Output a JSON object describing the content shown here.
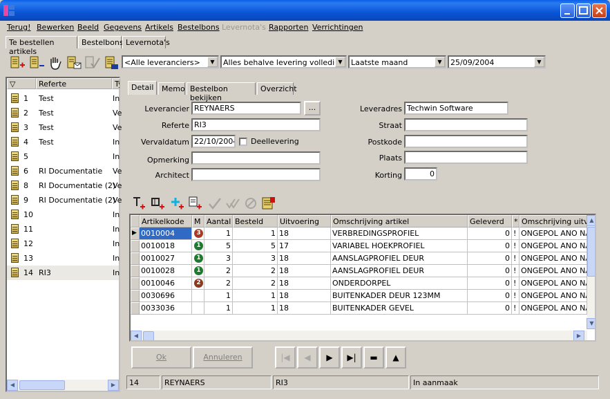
{
  "menu": [
    {
      "label": "Terug!",
      "disabled": false
    },
    {
      "label": "Bewerken",
      "disabled": false
    },
    {
      "label": "Beeld",
      "disabled": false
    },
    {
      "label": "Gegevens",
      "disabled": false
    },
    {
      "label": "Artikels",
      "disabled": false
    },
    {
      "label": "Bestelbons",
      "disabled": false
    },
    {
      "label": "Levernota's",
      "disabled": true
    },
    {
      "label": "Rapporten",
      "disabled": false
    },
    {
      "label": "Verrichtingen",
      "disabled": false
    }
  ],
  "top_tabs": [
    "Te bestellen artikels",
    "Bestelbons",
    "Levernota's"
  ],
  "filters": {
    "supplier": "<Alle leveranciers>",
    "status": "Alles behalve levering volledig",
    "period": "Laatste maand",
    "date": "25/09/2004"
  },
  "list": {
    "headers": [
      "▽",
      "Referte",
      "Ty"
    ],
    "rows": [
      {
        "nr": "1",
        "ref": "Test",
        "type": "In"
      },
      {
        "nr": "2",
        "ref": "Test",
        "type": "Ve"
      },
      {
        "nr": "3",
        "ref": "Test",
        "type": "Ve"
      },
      {
        "nr": "4",
        "ref": "Test",
        "type": "In"
      },
      {
        "nr": "5",
        "ref": "",
        "type": "In"
      },
      {
        "nr": "6",
        "ref": "RI Documentatie",
        "type": "Ve"
      },
      {
        "nr": "8",
        "ref": "RI Documentatie (2)",
        "type": "Ve"
      },
      {
        "nr": "9",
        "ref": "RI Documentatie (2)",
        "type": "Ve"
      },
      {
        "nr": "10",
        "ref": "",
        "type": "In"
      },
      {
        "nr": "11",
        "ref": "",
        "type": "In"
      },
      {
        "nr": "12",
        "ref": "",
        "type": "In"
      },
      {
        "nr": "13",
        "ref": "",
        "type": "In"
      },
      {
        "nr": "14",
        "ref": "RI3",
        "type": "In"
      }
    ]
  },
  "detail_tabs": [
    "Detail",
    "Memo",
    "Bestelbon bekijken",
    "Overzicht"
  ],
  "form": {
    "leverancier_label": "Leverancier",
    "leverancier": "REYNAERS",
    "browse": "...",
    "referte_label": "Referte",
    "referte": "RI3",
    "vervaldatum_label": "Vervaldatum",
    "vervaldatum": "22/10/2004",
    "deellevering_label": "Deellevering",
    "opmerking_label": "Opmerking",
    "opmerking": "",
    "architect_label": "Architect",
    "architect": "",
    "leveradres_label": "Leveradres",
    "leveradres": "Techwin Software",
    "straat_label": "Straat",
    "straat": "",
    "postkode_label": "Postkode",
    "postkode": "",
    "plaats_label": "Plaats",
    "plaats": "",
    "korting_label": "Korting",
    "korting": "0"
  },
  "grid": {
    "headers": [
      "Artikelkode",
      "M",
      "Aantal",
      "Besteld",
      "Uitvoering",
      "Omschrijving artikel",
      "Geleverd",
      "*",
      "Omschrijving uitvoe"
    ],
    "rows": [
      {
        "code": "0010004",
        "m": "3",
        "aantal": "1",
        "besteld": "1",
        "uitvoering": "18",
        "omschrijving": "VERBREDINGSPROFIEL",
        "geleverd": "0",
        "star": "!",
        "omschr_uitv": "ONGEPOL ANO NA"
      },
      {
        "code": "0010018",
        "m": "1",
        "aantal": "5",
        "besteld": "5",
        "uitvoering": "17",
        "omschrijving": "VARIABEL HOEKPROFIEL",
        "geleverd": "0",
        "star": "!",
        "omschr_uitv": "ONGEPOL ANO NA"
      },
      {
        "code": "0010027",
        "m": "1",
        "aantal": "3",
        "besteld": "3",
        "uitvoering": "18",
        "omschrijving": "AANSLAGPROFIEL DEUR",
        "geleverd": "0",
        "star": "!",
        "omschr_uitv": "ONGEPOL ANO NA"
      },
      {
        "code": "0010028",
        "m": "1",
        "aantal": "2",
        "besteld": "2",
        "uitvoering": "18",
        "omschrijving": "AANSLAGPROFIEL DEUR",
        "geleverd": "0",
        "star": "!",
        "omschr_uitv": "ONGEPOL ANO NA"
      },
      {
        "code": "0010046",
        "m": "2",
        "aantal": "2",
        "besteld": "2",
        "uitvoering": "18",
        "omschrijving": "ONDERDORPEL",
        "geleverd": "0",
        "star": "!",
        "omschr_uitv": "ONGEPOL ANO NA"
      },
      {
        "code": "0030696",
        "m": "",
        "aantal": "1",
        "besteld": "1",
        "uitvoering": "18",
        "omschrijving": "BUITENKADER DEUR 123MM",
        "geleverd": "0",
        "star": "!",
        "omschr_uitv": "ONGEPOL ANO NA"
      },
      {
        "code": "0033036",
        "m": "",
        "aantal": "1",
        "besteld": "1",
        "uitvoering": "18",
        "omschrijving": "BUITENKADER GEVEL",
        "geleverd": "0",
        "star": "!",
        "omschr_uitv": "ONGEPOL ANO NA"
      }
    ]
  },
  "buttons": {
    "ok": "Ok",
    "annuleren": "Annuleren"
  },
  "nav": [
    "|◀",
    "◀",
    "▶",
    "▶|",
    "▬",
    "▲"
  ],
  "status": [
    "14",
    "REYNAERS",
    "RI3",
    "In aanmaak"
  ],
  "colors": {
    "titlebar": "#0a5fe8",
    "selection": "#316ac5",
    "badge_red": "#a83a26",
    "badge_green": "#1f7a2e",
    "badge_brown": "#8a3a1e"
  }
}
